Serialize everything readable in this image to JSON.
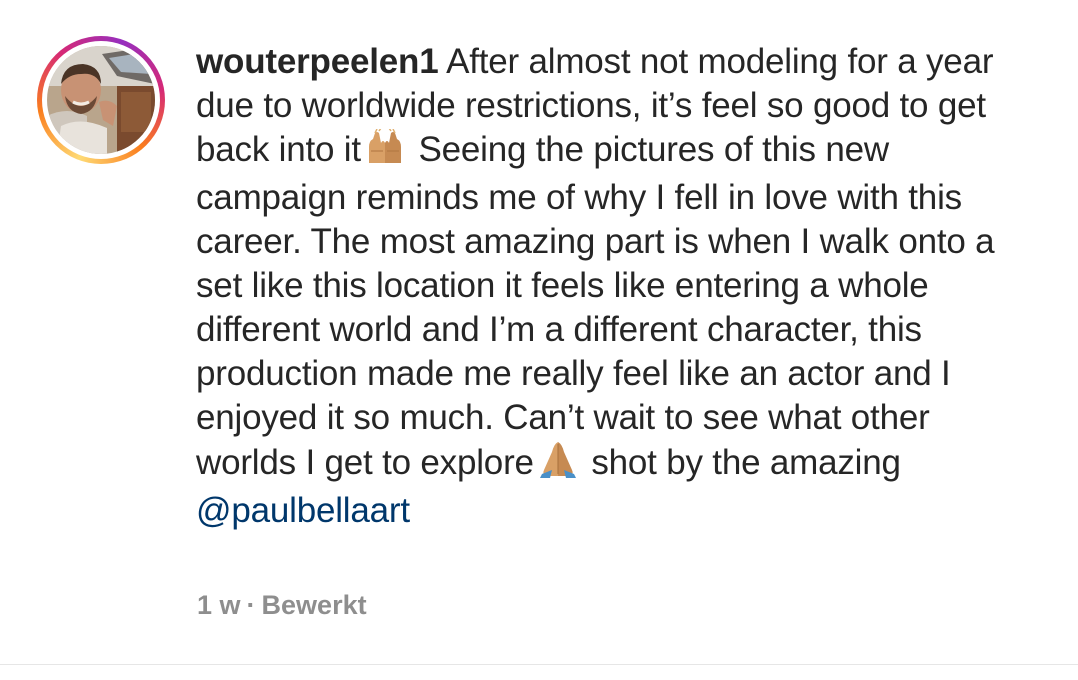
{
  "post": {
    "username": "wouterpeelen1",
    "caption_parts": {
      "p1": "After almost not modeling for a year due to worldwide restrictions, it’s feel so good to get back into it",
      "p2": "Seeing the pictures of this new campaign reminds me of why I fell in love with this career. The most amazing part is when I walk onto a set like this location it feels like entering a whole different world and I’m a different character, this production made me really feel like an actor and I enjoyed it so much. Can’t wait to see what other worlds I get to explore",
      "p3": "shot by the amazing",
      "mention": "@paulbellaart"
    },
    "emojis": {
      "first": "raising-hands-icon",
      "second": "folded-hands-icon"
    },
    "time": "1 w",
    "separator": "·",
    "edited_label": "Bewerkt"
  },
  "colors": {
    "text": "#262626",
    "mention": "#00376b",
    "meta": "#8e8e8e"
  }
}
